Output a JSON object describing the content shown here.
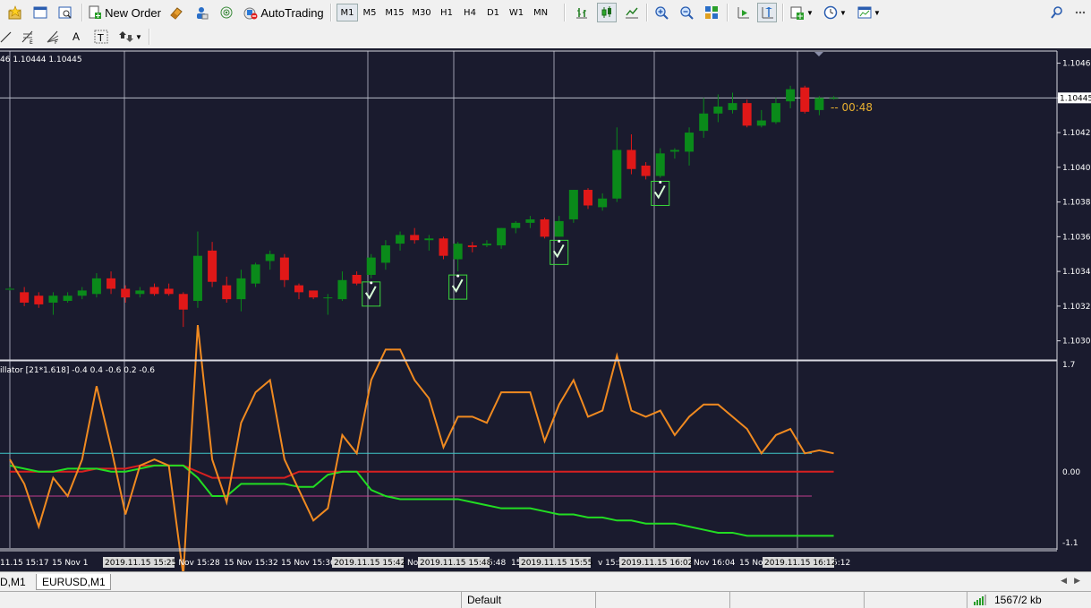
{
  "toolbar": {
    "new_order_label": "New Order",
    "autotrading_label": "AutoTrading",
    "timeframes": [
      "M1",
      "M5",
      "M15",
      "M30",
      "H1",
      "H4",
      "D1",
      "W1",
      "MN"
    ],
    "active_timeframe": "M1",
    "icons": {
      "favorites": "star-folder-icon",
      "profiles": "window-icon",
      "templates": "zoom-window-icon",
      "new_order": "new-order-icon",
      "market_watch": "eraser-icon",
      "data_window": "person-icon",
      "navigator": "signal-icon",
      "autotrading": "autotrading-icon",
      "bar_chart": "bar-chart-icon",
      "candle_chart": "candlestick-icon",
      "line_chart": "line-chart-icon",
      "zoom_in": "zoom-in-icon",
      "zoom_out": "zoom-out-icon",
      "tile": "tile-windows-icon",
      "autoscroll": "autoscroll-icon",
      "chart_shift": "chart-shift-icon",
      "indicators": "indicators-icon",
      "periods": "clock-icon",
      "templates2": "template-icon",
      "search": "search-icon"
    },
    "row2_icons": [
      "line-tool-icon",
      "fibonacci-icon",
      "fibo-fan-icon",
      "text-icon",
      "text-label-icon",
      "arrows-icon"
    ],
    "text_tool_label": "A"
  },
  "chart": {
    "info_text": "46 1.10444 1.10445",
    "countdown": "-- 00:48",
    "current_price_label": "1.10445",
    "price_axis": [
      "1.10465",
      "1.10445",
      "1.10425",
      "1.10405",
      "1.10385",
      "1.10365",
      "1.10345",
      "1.10325",
      "1.10305"
    ],
    "indicator_label": "illator [21*1.618] -0.4 0.4 -0.6 0.2 -0.6",
    "indicator_axis": [
      "1.7",
      "0.00",
      "-1.1"
    ],
    "time_labels": [
      "11.15 15:17",
      "15 Nov 1",
      "15 Nov 15:28",
      "15 Nov 15:32",
      "15 Nov 15:36",
      "No",
      "5:48",
      "15",
      "v 15:56",
      "Nov 16:04",
      "15 No",
      "5:12"
    ],
    "time_boxes": [
      "2019.11.15 15:25",
      "2019.11.15 15:42",
      "2019.11.15 15:48",
      "2019.11.15 15:55",
      "2019.11.15 16:02",
      "2019.11.15 16:12"
    ],
    "colors": {
      "background": "#1a1b2e",
      "bull": "#0a8a1a",
      "bear": "#e01818",
      "grid": "#c8c8d8",
      "orange": "#f08a20",
      "green": "#22dd22",
      "cyan": "#3ec8c8",
      "magenta": "#c03c8c",
      "countdown": "#e8b030"
    }
  },
  "chart_data": {
    "type": "candlestick",
    "y_unit": "price",
    "ylim": [
      1.10295,
      1.10472
    ],
    "candles": [
      {
        "o": 1.10335,
        "h": 1.10336,
        "l": 1.10334,
        "c": 1.10335
      },
      {
        "o": 1.10333,
        "h": 1.10336,
        "l": 1.10325,
        "c": 1.10327
      },
      {
        "o": 1.10331,
        "h": 1.10333,
        "l": 1.10324,
        "c": 1.10326
      },
      {
        "o": 1.10327,
        "h": 1.10333,
        "l": 1.1032,
        "c": 1.10331
      },
      {
        "o": 1.10328,
        "h": 1.10333,
        "l": 1.10327,
        "c": 1.10331
      },
      {
        "o": 1.10331,
        "h": 1.10336,
        "l": 1.10329,
        "c": 1.10334
      },
      {
        "o": 1.10332,
        "h": 1.10344,
        "l": 1.1033,
        "c": 1.10341
      },
      {
        "o": 1.10341,
        "h": 1.10345,
        "l": 1.10332,
        "c": 1.10335
      },
      {
        "o": 1.10335,
        "h": 1.10337,
        "l": 1.10327,
        "c": 1.1033
      },
      {
        "o": 1.10332,
        "h": 1.10336,
        "l": 1.1033,
        "c": 1.10334
      },
      {
        "o": 1.10336,
        "h": 1.10338,
        "l": 1.10331,
        "c": 1.10332
      },
      {
        "o": 1.10335,
        "h": 1.10338,
        "l": 1.10331,
        "c": 1.10332
      },
      {
        "o": 1.10332,
        "h": 1.10333,
        "l": 1.10313,
        "c": 1.10323
      },
      {
        "o": 1.10328,
        "h": 1.10368,
        "l": 1.10324,
        "c": 1.10354
      },
      {
        "o": 1.10357,
        "h": 1.10362,
        "l": 1.10336,
        "c": 1.10339
      },
      {
        "o": 1.10337,
        "h": 1.10342,
        "l": 1.10327,
        "c": 1.10329
      },
      {
        "o": 1.10329,
        "h": 1.10346,
        "l": 1.10322,
        "c": 1.10341
      },
      {
        "o": 1.10338,
        "h": 1.1035,
        "l": 1.10336,
        "c": 1.10349
      },
      {
        "o": 1.10351,
        "h": 1.10357,
        "l": 1.10346,
        "c": 1.10355
      },
      {
        "o": 1.10353,
        "h": 1.10355,
        "l": 1.10336,
        "c": 1.1034
      },
      {
        "o": 1.10337,
        "h": 1.10338,
        "l": 1.10329,
        "c": 1.10333
      },
      {
        "o": 1.10334,
        "h": 1.10334,
        "l": 1.10329,
        "c": 1.1033
      },
      {
        "o": 1.1033,
        "h": 1.10332,
        "l": 1.1032,
        "c": 1.1033
      },
      {
        "o": 1.10329,
        "h": 1.10345,
        "l": 1.10328,
        "c": 1.1034
      },
      {
        "o": 1.10343,
        "h": 1.10345,
        "l": 1.10337,
        "c": 1.10338
      },
      {
        "o": 1.10343,
        "h": 1.10355,
        "l": 1.10341,
        "c": 1.10353
      },
      {
        "o": 1.1035,
        "h": 1.10363,
        "l": 1.10346,
        "c": 1.1036
      },
      {
        "o": 1.10361,
        "h": 1.10368,
        "l": 1.10357,
        "c": 1.10366
      },
      {
        "o": 1.10366,
        "h": 1.1037,
        "l": 1.10361,
        "c": 1.10363
      },
      {
        "o": 1.10363,
        "h": 1.10366,
        "l": 1.10357,
        "c": 1.10364
      },
      {
        "o": 1.10364,
        "h": 1.10365,
        "l": 1.10352,
        "c": 1.10354
      },
      {
        "o": 1.10352,
        "h": 1.10362,
        "l": 1.10345,
        "c": 1.10361
      },
      {
        "o": 1.1036,
        "h": 1.10362,
        "l": 1.10356,
        "c": 1.10359
      },
      {
        "o": 1.1036,
        "h": 1.10363,
        "l": 1.10359,
        "c": 1.10361
      },
      {
        "o": 1.1036,
        "h": 1.1037,
        "l": 1.10358,
        "c": 1.1037
      },
      {
        "o": 1.1037,
        "h": 1.10374,
        "l": 1.10367,
        "c": 1.10373
      },
      {
        "o": 1.10373,
        "h": 1.10377,
        "l": 1.1037,
        "c": 1.10375
      },
      {
        "o": 1.10375,
        "h": 1.10376,
        "l": 1.10364,
        "c": 1.10365
      },
      {
        "o": 1.10365,
        "h": 1.10377,
        "l": 1.10365,
        "c": 1.10374
      },
      {
        "o": 1.10375,
        "h": 1.10392,
        "l": 1.10373,
        "c": 1.10392
      },
      {
        "o": 1.10392,
        "h": 1.10393,
        "l": 1.10381,
        "c": 1.10383
      },
      {
        "o": 1.10382,
        "h": 1.1039,
        "l": 1.1038,
        "c": 1.10387
      },
      {
        "o": 1.10387,
        "h": 1.10428,
        "l": 1.10385,
        "c": 1.10415
      },
      {
        "o": 1.10415,
        "h": 1.10424,
        "l": 1.10401,
        "c": 1.10404
      },
      {
        "o": 1.10406,
        "h": 1.10408,
        "l": 1.10398,
        "c": 1.104
      },
      {
        "o": 1.104,
        "h": 1.10416,
        "l": 1.10399,
        "c": 1.10413
      },
      {
        "o": 1.10414,
        "h": 1.10416,
        "l": 1.1041,
        "c": 1.10415
      },
      {
        "o": 1.10414,
        "h": 1.10428,
        "l": 1.10406,
        "c": 1.10425
      },
      {
        "o": 1.10426,
        "h": 1.10445,
        "l": 1.10422,
        "c": 1.10436
      },
      {
        "o": 1.10436,
        "h": 1.10447,
        "l": 1.10431,
        "c": 1.1044
      },
      {
        "o": 1.10438,
        "h": 1.10448,
        "l": 1.10436,
        "c": 1.10442
      },
      {
        "o": 1.10442,
        "h": 1.10444,
        "l": 1.10428,
        "c": 1.10429
      },
      {
        "o": 1.10429,
        "h": 1.10438,
        "l": 1.10428,
        "c": 1.10432
      },
      {
        "o": 1.10431,
        "h": 1.10445,
        "l": 1.1043,
        "c": 1.10442
      },
      {
        "o": 1.10443,
        "h": 1.10452,
        "l": 1.10439,
        "c": 1.1045
      },
      {
        "o": 1.10451,
        "h": 1.10452,
        "l": 1.10436,
        "c": 1.10437
      },
      {
        "o": 1.10438,
        "h": 1.10446,
        "l": 1.10435,
        "c": 1.10445
      },
      {
        "o": 1.10445,
        "h": 1.10446,
        "l": 1.10444,
        "c": 1.10445
      }
    ],
    "signals": [
      25,
      31,
      38,
      45
    ],
    "current_price": 1.10445,
    "indicator": {
      "ylim": [
        -1.25,
        1.8
      ],
      "levels": [
        0.3,
        -0.4
      ],
      "orange": [
        0.2,
        -0.2,
        -0.9,
        -0.1,
        -0.4,
        0.2,
        1.4,
        0.4,
        -0.7,
        0.1,
        0.2,
        0.1,
        -1.7,
        2.4,
        0.2,
        -0.5,
        0.8,
        1.3,
        1.5,
        0.2,
        -0.3,
        -0.8,
        -0.6,
        0.6,
        0.3,
        1.5,
        2.0,
        2.0,
        1.5,
        1.2,
        0.4,
        0.9,
        0.9,
        0.8,
        1.3,
        1.3,
        1.3,
        0.5,
        1.1,
        1.5,
        0.9,
        1.0,
        1.9,
        1.0,
        0.9,
        1.0,
        0.6,
        0.9,
        1.1,
        1.1,
        0.9,
        0.7,
        0.3,
        0.6,
        0.7,
        0.3,
        0.35,
        0.3
      ],
      "red_line": [
        0.0,
        0.0,
        0.0,
        0.0,
        0.0,
        0.0,
        0.05,
        0.05,
        0.05,
        0.1,
        0.1,
        0.1,
        0.1,
        0.0,
        -0.1,
        -0.1,
        -0.1,
        -0.1,
        -0.1,
        -0.1,
        0.0,
        0.0,
        0.0,
        0.0,
        0.0,
        0.0,
        0.0,
        0.0,
        0.0,
        0.0,
        0.0,
        0.0,
        0.0,
        0.0,
        0.0,
        0.0,
        0.0,
        0.0,
        0.0,
        0.0,
        0.0,
        0.0,
        0.0,
        0.0,
        0.0,
        0.0,
        0.0,
        0.0,
        0.0,
        0.0,
        0.0,
        0.0,
        0.0,
        0.0,
        0.0,
        0.0,
        0.0,
        0.0
      ],
      "green": [
        0.1,
        0.05,
        0.0,
        0.0,
        0.05,
        0.05,
        0.05,
        0.0,
        0.0,
        0.05,
        0.1,
        0.1,
        0.1,
        -0.1,
        -0.4,
        -0.4,
        -0.2,
        -0.2,
        -0.2,
        -0.2,
        -0.25,
        -0.25,
        -0.05,
        0.0,
        0.0,
        -0.3,
        -0.4,
        -0.45,
        -0.45,
        -0.45,
        -0.45,
        -0.45,
        -0.5,
        -0.55,
        -0.6,
        -0.6,
        -0.6,
        -0.65,
        -0.7,
        -0.7,
        -0.75,
        -0.75,
        -0.8,
        -0.8,
        -0.85,
        -0.85,
        -0.85,
        -0.9,
        -0.95,
        -1.0,
        -1.0,
        -1.05,
        -1.05,
        -1.05,
        -1.05,
        -1.05,
        -1.05,
        -1.05
      ]
    }
  },
  "tabs": {
    "partial_label": "D,M1",
    "active_label": "EURUSD,M1"
  },
  "status": {
    "profile": "Default",
    "traffic": "1567/2 kb"
  }
}
